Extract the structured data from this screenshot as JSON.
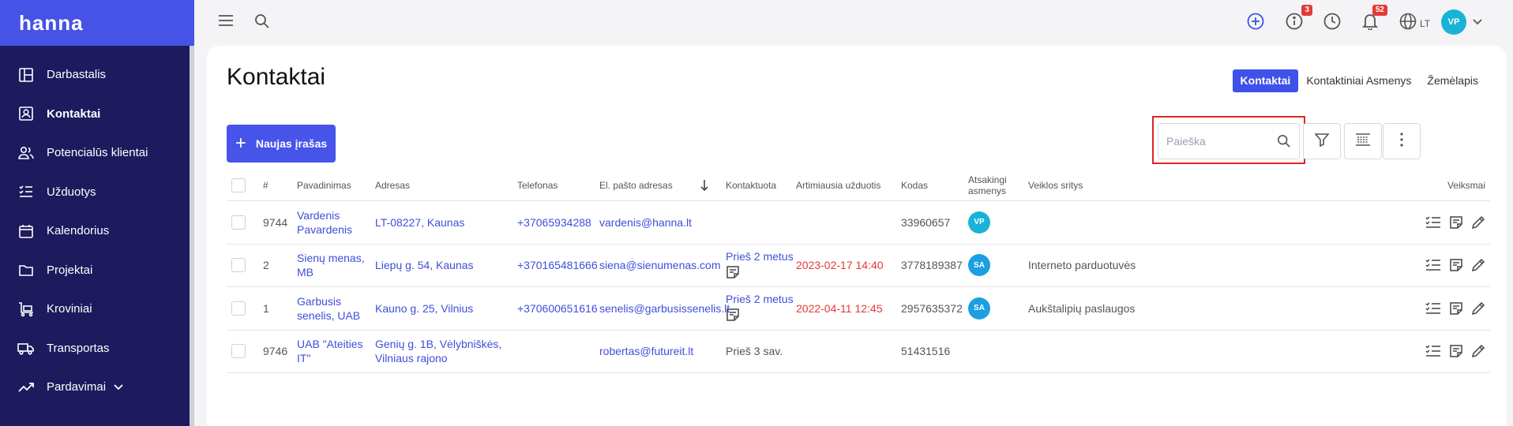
{
  "brand": "hanna",
  "sidebar": {
    "items": [
      {
        "label": "Darbastalis",
        "icon": "dashboard-icon"
      },
      {
        "label": "Kontaktai",
        "icon": "contacts-icon",
        "active": true
      },
      {
        "label": "Potencialūs klientai",
        "icon": "leads-icon"
      },
      {
        "label": "Užduotys",
        "icon": "tasks-icon"
      },
      {
        "label": "Kalendorius",
        "icon": "calendar-icon"
      },
      {
        "label": "Projektai",
        "icon": "folder-icon"
      },
      {
        "label": "Kroviniai",
        "icon": "cargo-icon"
      },
      {
        "label": "Transportas",
        "icon": "truck-icon"
      },
      {
        "label": "Pardavimai",
        "icon": "sales-icon"
      }
    ]
  },
  "topbar": {
    "info_badge": "3",
    "notif_badge": "52",
    "language": "LT",
    "user_initials": "VP"
  },
  "page": {
    "title": "Kontaktai",
    "tabs": [
      "Kontaktai",
      "Kontaktiniai Asmenys",
      "Žemėlapis"
    ],
    "new_button": "Naujas įrašas",
    "search_placeholder": "Paieška"
  },
  "table": {
    "headers": {
      "num": "#",
      "name": "Pavadinimas",
      "address": "Adresas",
      "phone": "Telefonas",
      "email": "El. pašto adresas",
      "contacted": "Kontaktuota",
      "next_task": "Artimiausia užduotis",
      "code": "Kodas",
      "responsible1": "Atsakingi",
      "responsible2": "asmenys",
      "industry": "Veiklos sritys",
      "actions": "Veiksmai"
    },
    "rows": [
      {
        "num": "9744",
        "name1": "Vardenis",
        "name2": "Pavardenis",
        "addr1": "LT-08227, Kaunas",
        "addr2": "",
        "phone": "+37065934288",
        "email": "vardenis@hanna.lt",
        "contacted": "",
        "task": "",
        "code": "33960657",
        "avatar": "VP",
        "industry": ""
      },
      {
        "num": "2",
        "name1": "Sienų menas,",
        "name2": "MB",
        "addr1": "Liepų g. 54, Kaunas",
        "addr2": "",
        "phone": "+370165481666",
        "email": "siena@sienumenas.com",
        "contacted": "Prieš 2 metus",
        "task": "2023-02-17 14:40",
        "code": "3778189387",
        "avatar": "SA",
        "industry": "Interneto parduotuvės"
      },
      {
        "num": "1",
        "name1": "Garbusis",
        "name2": "senelis, UAB",
        "addr1": "Kauno g. 25, Vilnius",
        "addr2": "",
        "phone": "+370600651616",
        "email": "senelis@garbusissenelis.lt",
        "contacted": "Prieš 2 metus",
        "task": "2022-04-11 12:45",
        "code": "2957635372",
        "avatar": "SA",
        "industry": "Aukštalipių paslaugos"
      },
      {
        "num": "9746",
        "name1": "UAB \"Ateities",
        "name2": "IT\"",
        "addr1": "Genių g. 1B, Vėlybniškės,",
        "addr2": "Vilniaus rajono",
        "phone": "",
        "email": "robertas@futureit.lt",
        "contacted": "Prieš 3 sav.",
        "task": "",
        "code": "51431516",
        "avatar": "",
        "industry": ""
      }
    ]
  },
  "colors": {
    "accent": "#3f51e8",
    "sidebar": "#1e1a5e",
    "danger": "#e53935",
    "avatar_vp": "#1ab3d8",
    "avatar_sa": "#1c9fe0"
  }
}
